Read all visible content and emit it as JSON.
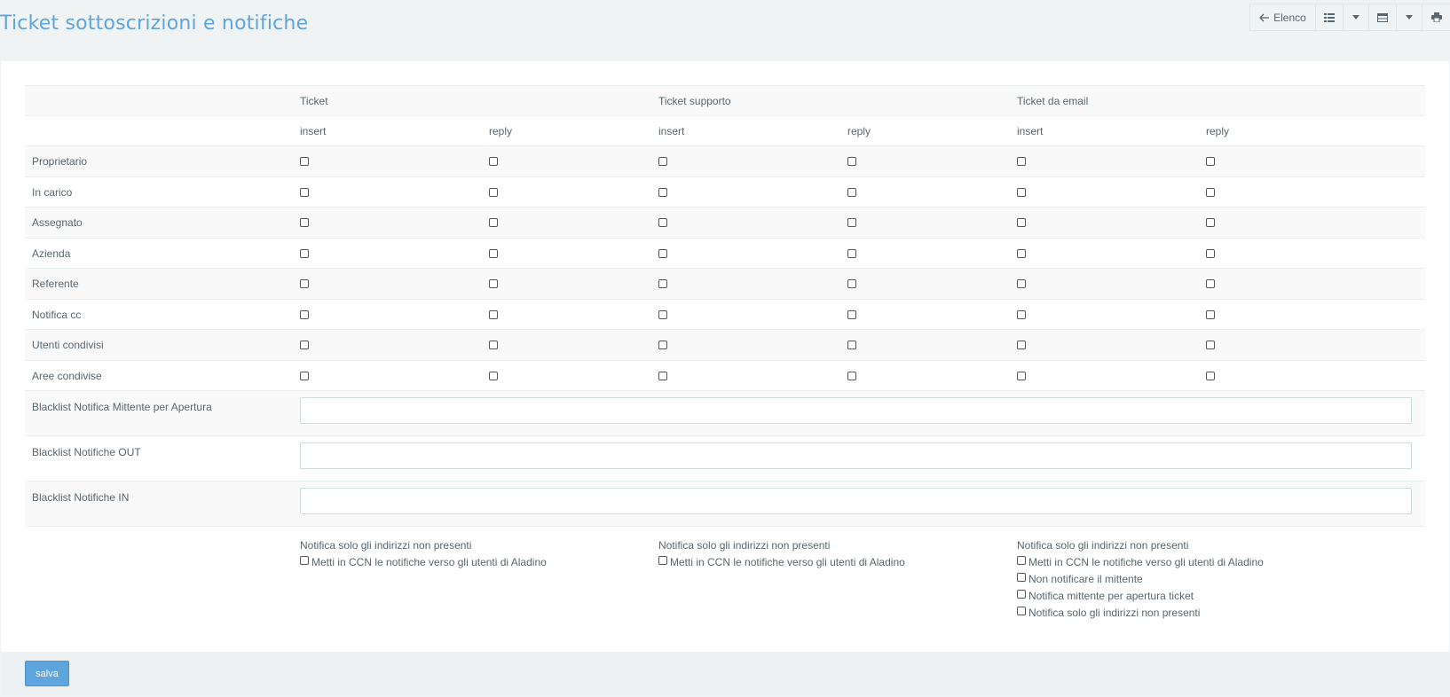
{
  "page": {
    "title": "Ticket sottoscrizioni e notifiche"
  },
  "toolbar": {
    "back_label": "Elenco",
    "icons": [
      "arrow-left-icon",
      "list-view-icon",
      "chevron-down-icon",
      "table-view-icon",
      "chevron-down-icon",
      "print-icon"
    ]
  },
  "table": {
    "groups": [
      "Ticket",
      "Ticket supporto",
      "Ticket da email"
    ],
    "subcols": [
      "insert",
      "reply",
      "insert",
      "reply",
      "insert",
      "reply"
    ],
    "rows": [
      "Proprietario",
      "In carico",
      "Assegnato",
      "Azienda",
      "Referente",
      "Notifica cc",
      "Utenti condivisi",
      "Aree condivise"
    ],
    "blacklists": [
      {
        "label": "Blacklist Notifica Mittente per Apertura",
        "value": ""
      },
      {
        "label": "Blacklist Notifiche OUT",
        "value": ""
      },
      {
        "label": "Blacklist Notifiche IN",
        "value": ""
      }
    ]
  },
  "options": {
    "ticket": {
      "title": "Notifica solo gli indirizzi non presenti",
      "items": [
        "Metti in CCN le notifiche verso gli utenti di Aladino"
      ]
    },
    "supporto": {
      "title": "Notifica solo gli indirizzi non presenti",
      "items": [
        "Metti in CCN le notifiche verso gli utenti di Aladino"
      ]
    },
    "email": {
      "title": "Notifica solo gli indirizzi non presenti",
      "items": [
        "Metti in CCN le notifiche verso gli utenti di Aladino",
        "Non notificare il mittente",
        "Notifica mittente per apertura ticket",
        "Notifica solo gli indirizzi non presenti"
      ]
    }
  },
  "footer": {
    "save_label": "salva"
  },
  "colors": {
    "accent": "#5ea5de",
    "background": "#f0f3f4",
    "text": "#58666e"
  }
}
